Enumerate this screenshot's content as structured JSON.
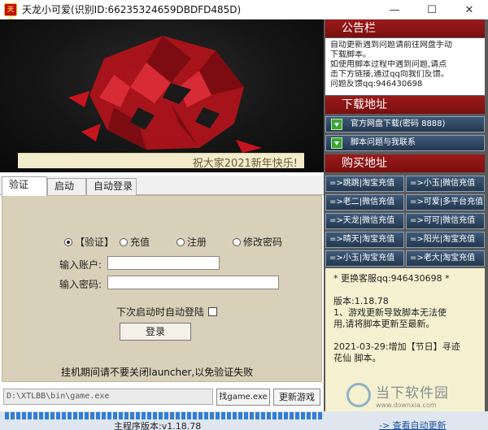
{
  "window": {
    "icon_text": "天龙",
    "title": "天龙小可爱(识别ID:66235324659DBDFD485D)",
    "min_symbol": "—",
    "max_symbol": "☐",
    "close_symbol": "✕"
  },
  "banner": {
    "greeting": "祝大家2021新年快乐!"
  },
  "tabs": [
    "验证",
    "启动",
    "自动登录"
  ],
  "login_form": {
    "options": [
      "【验证】",
      "充值",
      "注册",
      "修改密码"
    ],
    "selected_option": 0,
    "account_label": "输入账户:",
    "account_value": "",
    "password_label": "输入密码:",
    "password_value": "",
    "autologin_label": "下次启动时自动登陆",
    "autologin_checked": false,
    "login_button": "登录",
    "warning": "挂机期间请不要关闭launcher,以免验证失败"
  },
  "bottom": {
    "path_value": "D:\\XTLBB\\bin\\game.exe",
    "find_button": "找game.exe",
    "update_button": "更新游戏",
    "progress_fraction": 1.0,
    "version_text": "主程序版本:v1.18.78",
    "auto_update_link": "-> 查看自动更新"
  },
  "right_panel": {
    "notice_title": "公告栏",
    "notice_lines": [
      "自动更新遇到问题请前往网盘手动",
      "下载脚本。",
      "如使用脚本过程中遇到问题,请点",
      "击下方链接,通过qq向我们反馈。",
      "问题反馈qq:946430698"
    ],
    "download_title": "下载地址",
    "download_buttons": [
      "官方网盘下载(密码 8888)",
      "脚本问题与我联系"
    ],
    "buy_title": "购买地址",
    "shop_buttons": [
      "=>跳跳|淘宝充值",
      "=>小玉|微信充值",
      "=>老二|微信充值",
      "=>可爱|多平台充值",
      "=>天龙|微信充值",
      "=>可可|微信充值",
      "=>晴天|淘宝充值",
      "=>阳光|淘宝充值",
      "=>小玉|淘宝充值",
      "=>老大|淘宝充值"
    ],
    "info_lines": [
      "* 更换客服qq:946430698 *",
      "",
      "版本:1.18.78",
      "1、游戏更新导致脚本无法使",
      "用,请将脚本更新至最新。",
      "",
      "2021-03-29:增加【节日】寻迹",
      "花仙 脚本。"
    ]
  },
  "watermark": {
    "title": "当下软件园",
    "subtitle": "www.downxia.com"
  },
  "colors": {
    "accent_red": "#9c1a1a",
    "button_blue": "#2f4a66",
    "form_bg": "#d8d0b8",
    "info_bg": "#f5f1d0",
    "progress_blue": "#2f7fd6"
  },
  "icons": [
    "app-icon",
    "minimize-icon",
    "maximize-icon",
    "close-icon",
    "download-arrow-icon",
    "dragon-emblem"
  ]
}
